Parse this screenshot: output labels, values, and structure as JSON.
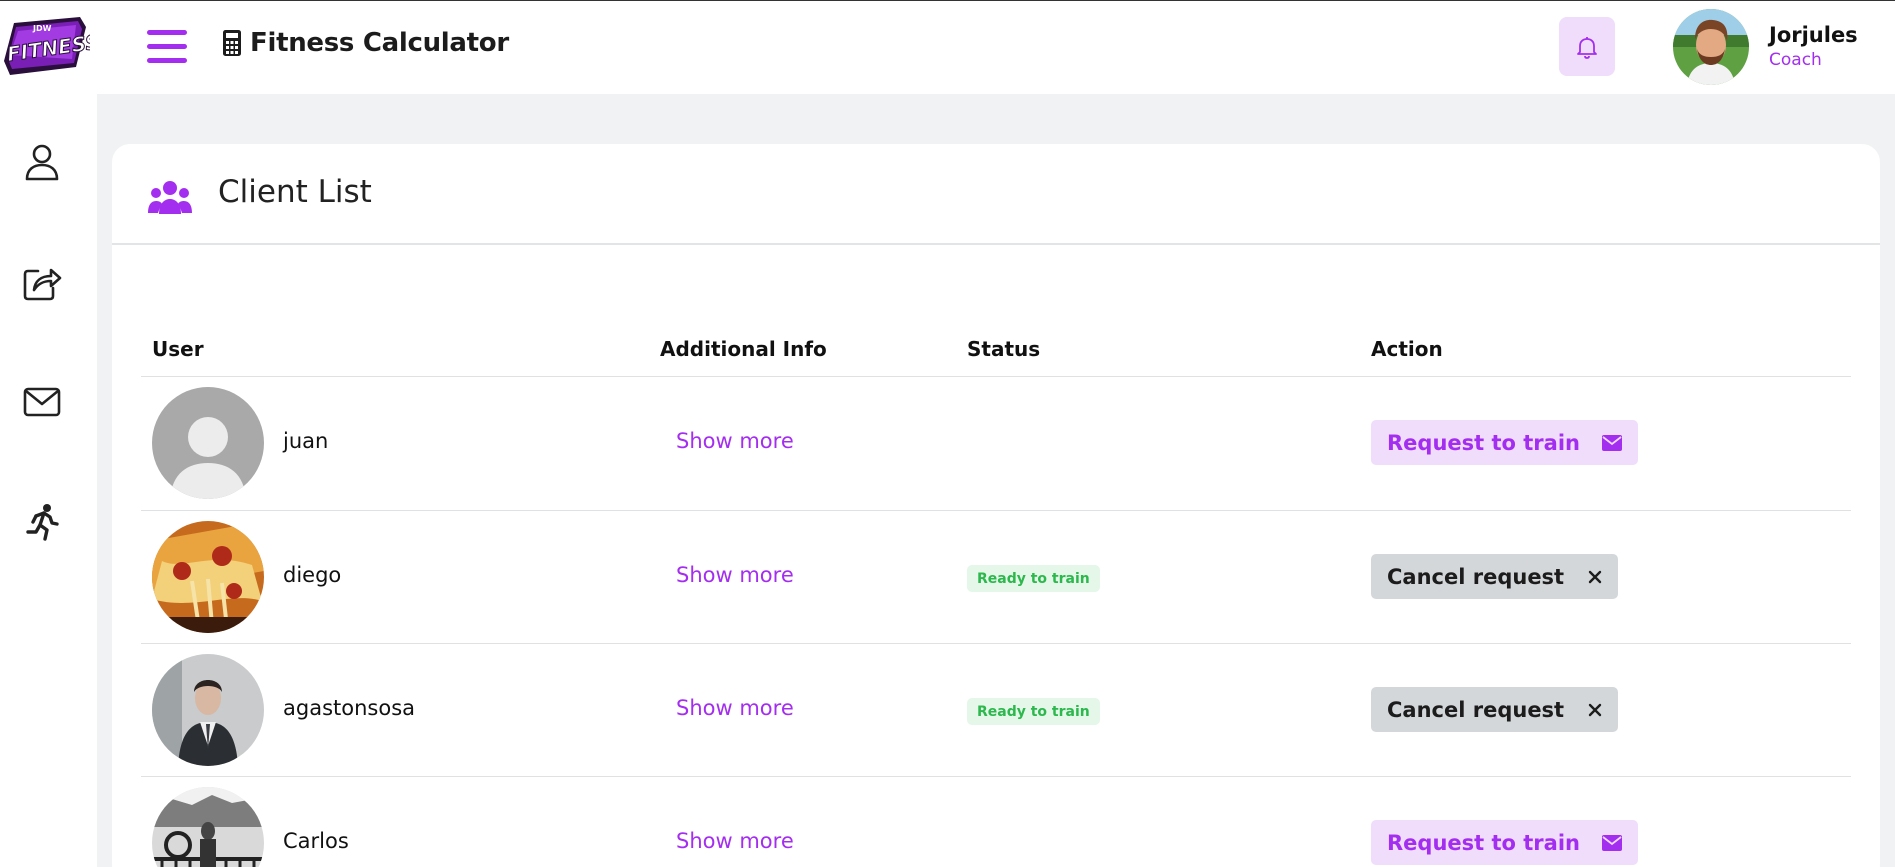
{
  "header": {
    "app_title": "Fitness Calculator",
    "user_name": "Jorjules",
    "user_role": "Coach"
  },
  "logo": {
    "top_text": "JDW",
    "main_text": "FITNESS"
  },
  "sidebar": {
    "items": [
      {
        "icon": "user-icon"
      },
      {
        "icon": "share-icon"
      },
      {
        "icon": "mail-icon"
      },
      {
        "icon": "running-icon"
      }
    ]
  },
  "card": {
    "title": "Client List",
    "columns": [
      "User",
      "Additional Info",
      "Status",
      "Action"
    ]
  },
  "rows": [
    {
      "name": "juan",
      "info": "Show more",
      "status": "",
      "action": "Request to train",
      "avatar": "default-avatar"
    },
    {
      "name": "diego",
      "info": "Show more",
      "status": "Ready to train",
      "action": "Cancel request",
      "avatar": "pizza-photo"
    },
    {
      "name": "agastonsosa",
      "info": "Show more",
      "status": "Ready to train",
      "action": "Cancel request",
      "avatar": "man-in-suit-photo"
    },
    {
      "name": "Carlos",
      "info": "Show more",
      "status": "",
      "action": "Request to train",
      "avatar": "bw-photo"
    }
  ],
  "colors": {
    "accent": "#a42ef0",
    "accent_light": "#f0dcfb",
    "status_green": "#2db84d",
    "cancel_gray": "#d4d7da"
  }
}
